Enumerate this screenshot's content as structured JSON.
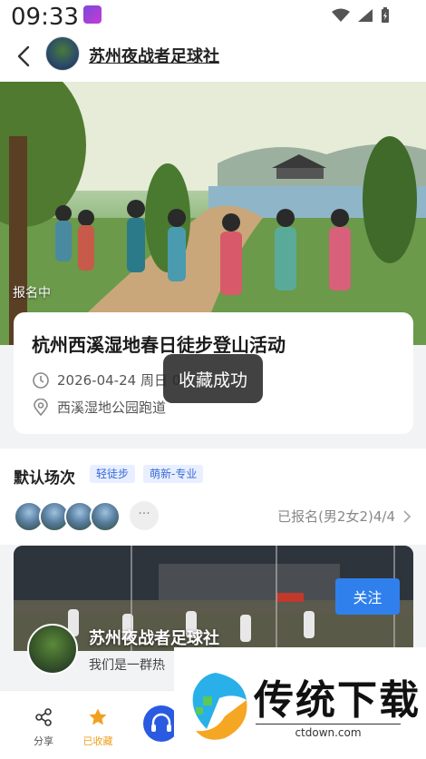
{
  "status_bar": {
    "time": "09:33"
  },
  "header": {
    "title": "苏州夜战者足球社"
  },
  "hero": {
    "status": "报名中"
  },
  "event": {
    "title": "杭州西溪湿地春日徒步登山活动",
    "datetime": "2026-04-24 周日 0",
    "location": "西溪湿地公园跑道"
  },
  "toast": {
    "text": "收藏成功"
  },
  "session": {
    "title": "默认场次",
    "tags": [
      "轻徒步",
      "萌新-专业"
    ],
    "more": "···",
    "signup_text": "已报名(男2女2)4/4"
  },
  "club": {
    "name": "苏州夜战者足球社",
    "follow_label": "关注",
    "description": "我们是一群热"
  },
  "bottom_bar": {
    "share_label": "分享",
    "fav_label": "已收藏"
  },
  "watermark": {
    "title": "传统下载",
    "url": "ctdown.com"
  },
  "colors": {
    "accent": "#2f80ed",
    "fav": "#f0a020",
    "tag_text": "#3a6bd6",
    "tag_bg": "#e8efff"
  }
}
